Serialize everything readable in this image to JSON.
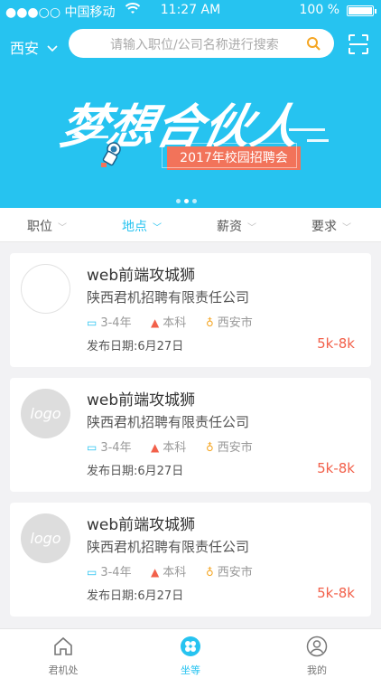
{
  "status": {
    "carrier": "●●●○○ 中国移动",
    "time": "11:27 AM",
    "battery": "100 %"
  },
  "header": {
    "city": "西安",
    "search_placeholder": "请输入职位/公司名称进行搜索"
  },
  "banner": {
    "title": "梦想合伙人",
    "subtitle": "2017年校园招聘会",
    "page_count": 3,
    "active_page": 1
  },
  "filters": [
    {
      "label": "职位",
      "active": false
    },
    {
      "label": "地点",
      "active": true
    },
    {
      "label": "薪资",
      "active": false
    },
    {
      "label": "要求",
      "active": false
    }
  ],
  "jobs": [
    {
      "logo": "",
      "title": "web前端攻城狮",
      "company": "陕西君机招聘有限责任公司",
      "experience": "3-4年",
      "education": "本科",
      "location": "西安市",
      "date": "发布日期:6月27日",
      "salary": "5k-8k"
    },
    {
      "logo": "logo",
      "title": "web前端攻城狮",
      "company": "陕西君机招聘有限责任公司",
      "experience": "3-4年",
      "education": "本科",
      "location": "西安市",
      "date": "发布日期:6月27日",
      "salary": "5k-8k"
    },
    {
      "logo": "logo",
      "title": "web前端攻城狮",
      "company": "陕西君机招聘有限责任公司",
      "experience": "3-4年",
      "education": "本科",
      "location": "西安市",
      "date": "发布日期:6月27日",
      "salary": "5k-8k"
    }
  ],
  "tabs": [
    {
      "label": "君机处",
      "icon": "home-icon",
      "active": false
    },
    {
      "label": "坐等",
      "icon": "clover-icon",
      "active": true
    },
    {
      "label": "我的",
      "icon": "user-icon",
      "active": false
    }
  ],
  "colors": {
    "brand": "#26c3f0",
    "salary": "#f2604a",
    "badge": "#f2735a"
  }
}
